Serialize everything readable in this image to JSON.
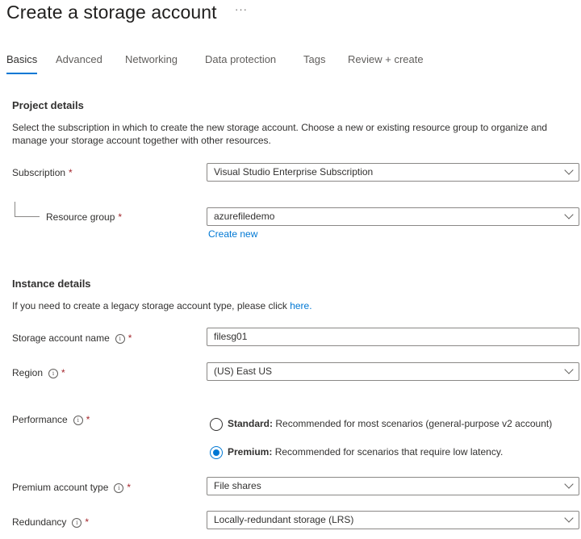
{
  "header": {
    "title": "Create a storage account",
    "more_label": "···"
  },
  "tabs": [
    {
      "label": "Basics",
      "active": true
    },
    {
      "label": "Advanced",
      "active": false
    },
    {
      "label": "Networking",
      "active": false
    },
    {
      "label": "Data protection",
      "active": false
    },
    {
      "label": "Tags",
      "active": false
    },
    {
      "label": "Review + create",
      "active": false
    }
  ],
  "project": {
    "title": "Project details",
    "description": "Select the subscription in which to create the new storage account. Choose a new or existing resource group to organize and manage your storage account together with other resources.",
    "subscription": {
      "label": "Subscription",
      "required": "*",
      "value": "Visual Studio Enterprise Subscription"
    },
    "resource_group": {
      "label": "Resource group",
      "required": "*",
      "value": "azurefiledemo",
      "create_new": "Create new"
    }
  },
  "instance": {
    "title": "Instance details",
    "description_prefix": "If you need to create a legacy storage account type, please click ",
    "description_link": "here.",
    "storage_account_name": {
      "label": "Storage account name",
      "required": "*",
      "value": "filesg01"
    },
    "region": {
      "label": "Region",
      "required": "*",
      "value": "(US) East US"
    },
    "performance": {
      "label": "Performance",
      "required": "*",
      "options": [
        {
          "name": "Standard:",
          "description": "Recommended for most scenarios (general-purpose v2 account)",
          "selected": false
        },
        {
          "name": "Premium:",
          "description": "Recommended for scenarios that require low latency.",
          "selected": true
        }
      ]
    },
    "premium_account_type": {
      "label": "Premium account type",
      "required": "*",
      "value": "File shares"
    },
    "redundancy": {
      "label": "Redundancy",
      "required": "*",
      "value": "Locally-redundant storage (LRS)"
    }
  },
  "icons": {
    "info": "i"
  },
  "colors": {
    "accent": "#0078d4",
    "required": "#a4262c"
  }
}
